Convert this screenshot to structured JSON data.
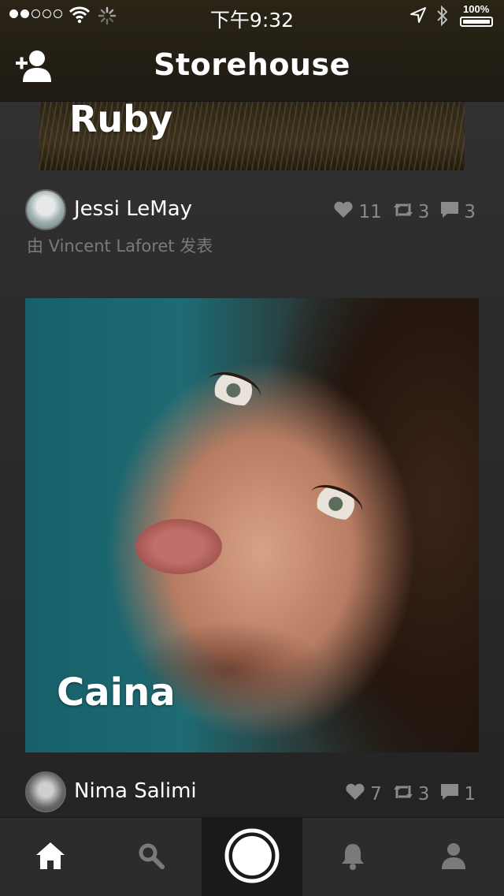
{
  "status_bar": {
    "time": "下午9:32",
    "battery_label": "100%",
    "battery_level": 1.0,
    "signal_bars_filled": 2,
    "signal_bars_total": 5,
    "icons": [
      "wifi-icon",
      "activity-spinner-icon",
      "location-arrow-icon",
      "bluetooth-icon",
      "battery-icon"
    ]
  },
  "navbar": {
    "title": "Storehouse",
    "left_icon": "add-user-icon"
  },
  "feed": {
    "cards": [
      {
        "title": "Ruby",
        "author": "",
        "byline": "",
        "stats": null
      },
      {
        "title": "Caina",
        "author": "Nima Salimi",
        "stats": {
          "likes": "7",
          "reposts": "3",
          "comments": "1"
        }
      }
    ],
    "posts": [
      {
        "author": "Jessi LeMay",
        "byline": "由 Vincent Laforet 发表",
        "stats": {
          "likes": "11",
          "reposts": "3",
          "comments": "3"
        }
      },
      {
        "author": "Nima Salimi",
        "stats": {
          "likes": "7",
          "reposts": "3",
          "comments": "1"
        }
      }
    ]
  },
  "tabbar": {
    "items": [
      {
        "icon": "home-icon",
        "active": true
      },
      {
        "icon": "search-icon",
        "active": false
      },
      {
        "icon": "capture-button-icon",
        "active": false
      },
      {
        "icon": "notifications-bell-icon",
        "active": false
      },
      {
        "icon": "profile-icon",
        "active": false
      }
    ]
  },
  "colors": {
    "background": "#2a2a2a",
    "navbar": "#221e16",
    "muted_text": "#8a8a8a",
    "tabbar": "#2c2c2c"
  }
}
